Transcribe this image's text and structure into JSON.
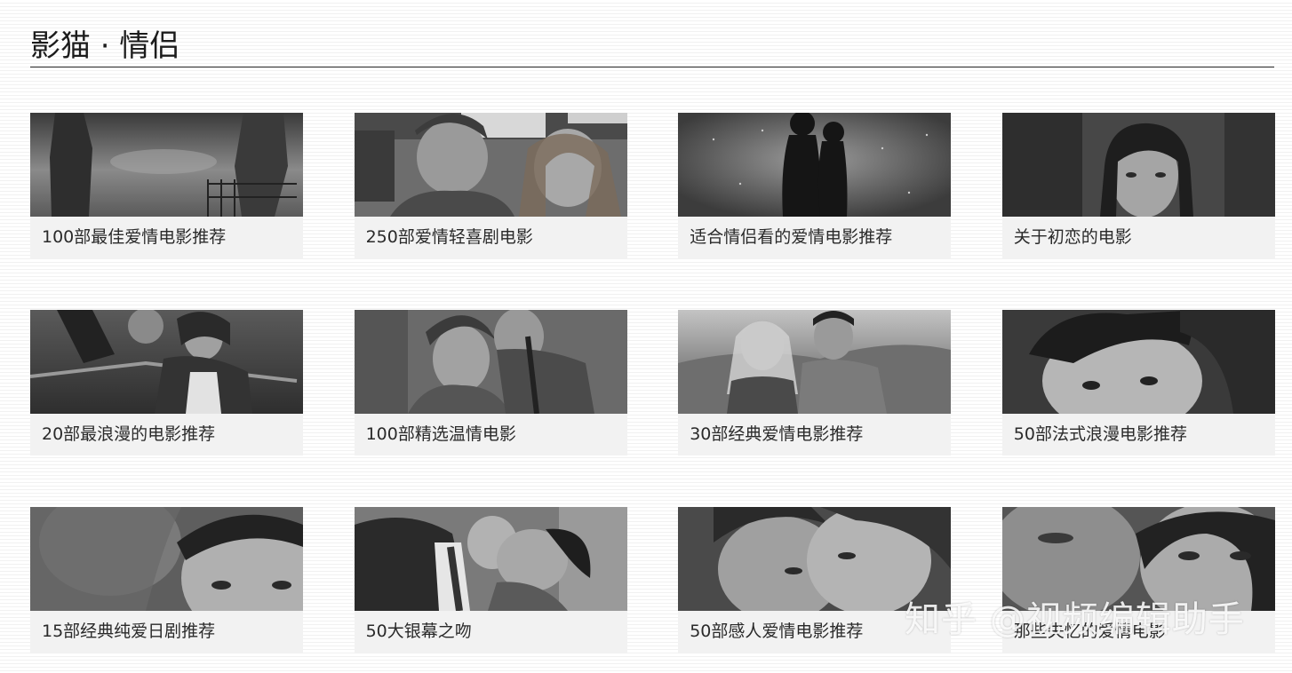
{
  "page": {
    "title": "影猫 · 情侣"
  },
  "cards": [
    {
      "title": "100部最佳爱情电影推荐"
    },
    {
      "title": "250部爱情轻喜剧电影"
    },
    {
      "title": "适合情侣看的爱情电影推荐"
    },
    {
      "title": "关于初恋的电影"
    },
    {
      "title": "20部最浪漫的电影推荐"
    },
    {
      "title": "100部精选温情电影"
    },
    {
      "title": "30部经典爱情电影推荐"
    },
    {
      "title": "50部法式浪漫电影推荐"
    },
    {
      "title": "15部经典纯爱日剧推荐"
    },
    {
      "title": "50大银幕之吻"
    },
    {
      "title": "50部感人爱情电影推荐"
    },
    {
      "title": "那些失忆的爱情电影"
    }
  ],
  "watermark": "知乎 @视频编辑助手"
}
